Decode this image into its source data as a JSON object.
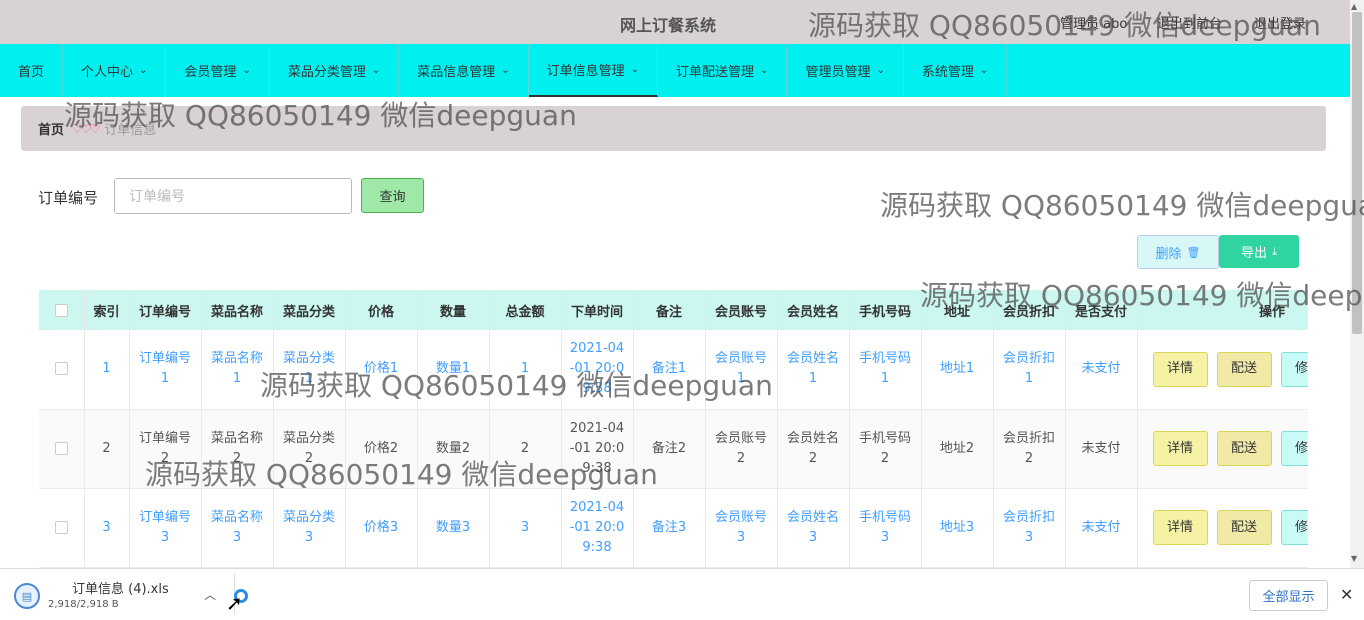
{
  "header": {
    "title": "网上订餐系统",
    "user_label": "管理员 abo",
    "center_label": "退出到前台",
    "logout_label": "退出登录"
  },
  "nav": [
    {
      "label": "首页",
      "has_chevron": false
    },
    {
      "label": "个人中心",
      "has_chevron": true
    },
    {
      "label": "会员管理",
      "has_chevron": true
    },
    {
      "label": "菜品分类管理",
      "has_chevron": true
    },
    {
      "label": "菜品信息管理",
      "has_chevron": true
    },
    {
      "label": "订单信息管理",
      "has_chevron": true
    },
    {
      "label": "订单配送管理",
      "has_chevron": true
    },
    {
      "label": "管理员管理",
      "has_chevron": true
    },
    {
      "label": "系统管理",
      "has_chevron": true
    }
  ],
  "breadcrumb": {
    "home": "首页",
    "sep": "♡♡♡",
    "current": "订单信息"
  },
  "search": {
    "label": "订单编号",
    "placeholder": "订单编号",
    "button": "查询"
  },
  "toolbar": {
    "delete_label": "删除",
    "delete_icon": "🗑",
    "export_label": "导出",
    "export_icon": "⤓"
  },
  "table": {
    "headers": [
      "索引",
      "订单编号",
      "菜品名称",
      "菜品分类",
      "价格",
      "数量",
      "总金额",
      "下单时间",
      "备注",
      "会员账号",
      "会员姓名",
      "手机号码",
      "地址",
      "会员折扣",
      "是否支付",
      "操作"
    ],
    "rows": [
      {
        "style": "link",
        "cells": [
          "1",
          "订单编号1",
          "菜品名称1",
          "菜品分类1",
          "价格1",
          "数量1",
          "1",
          "2021-04-01 20:09:38",
          "备注1",
          "会员账号1",
          "会员姓名1",
          "手机号码1",
          "地址1",
          "会员折扣1",
          "未支付"
        ]
      },
      {
        "style": "plain",
        "cells": [
          "2",
          "订单编号2",
          "菜品名称2",
          "菜品分类2",
          "价格2",
          "数量2",
          "2",
          "2021-04-01 20:09:38",
          "备注2",
          "会员账号2",
          "会员姓名2",
          "手机号码2",
          "地址2",
          "会员折扣2",
          "未支付"
        ]
      },
      {
        "style": "link",
        "cells": [
          "3",
          "订单编号3",
          "菜品名称3",
          "菜品分类3",
          "价格3",
          "数量3",
          "3",
          "2021-04-01 20:09:38",
          "备注3",
          "会员账号3",
          "会员姓名3",
          "手机号码3",
          "地址3",
          "会员折扣3",
          "未支付"
        ]
      }
    ],
    "actions": [
      "详情",
      "配送",
      "修改"
    ]
  },
  "download": {
    "file_name": "订单信息 (4).xls",
    "file_size": "2,918/2,918 B",
    "show_all": "全部显示",
    "close": "✕"
  },
  "watermark": "源码获取 QQ86050149 微信deepguan"
}
